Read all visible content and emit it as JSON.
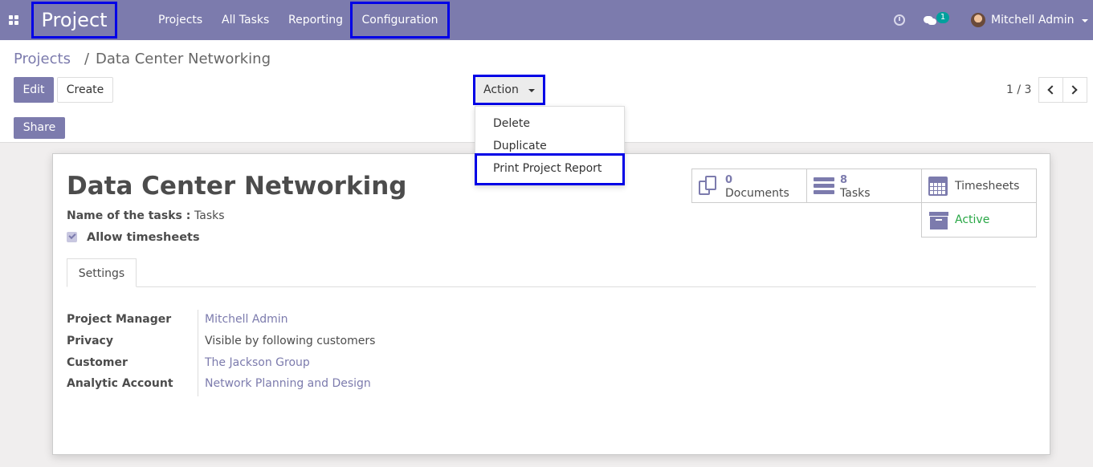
{
  "navbar": {
    "brand": "Project",
    "menu": [
      "Projects",
      "All Tasks",
      "Reporting",
      "Configuration"
    ],
    "chat_badge": "1",
    "user": "Mitchell Admin"
  },
  "breadcrumb": {
    "parent": "Projects",
    "separator": "/",
    "current": "Data Center Networking"
  },
  "buttons": {
    "edit": "Edit",
    "create": "Create",
    "share": "Share",
    "action": "Action"
  },
  "pager": {
    "value": "1 / 3"
  },
  "action_menu": [
    "Delete",
    "Duplicate",
    "Print Project Report"
  ],
  "record": {
    "title": "Data Center Networking",
    "tasks_label": "Name of the tasks :",
    "tasks_value": "Tasks",
    "allow_timesheets": "Allow timesheets",
    "tab": "Settings",
    "fields": [
      {
        "label": "Project Manager",
        "value": "Mitchell Admin"
      },
      {
        "label": "Privacy",
        "value": "Visible by following customers"
      },
      {
        "label": "Customer",
        "value": "The Jackson Group"
      },
      {
        "label": "Analytic Account",
        "value": "Network Planning and Design"
      }
    ]
  },
  "stats": {
    "documents": {
      "count": "0",
      "label": "Documents"
    },
    "tasks": {
      "count": "8",
      "label": "Tasks"
    },
    "timesheets": {
      "label": "Timesheets"
    },
    "active": {
      "label": "Active"
    }
  },
  "colors": {
    "brand": "#7c7bad",
    "highlight": "#0000e6",
    "active": "#28a745"
  }
}
